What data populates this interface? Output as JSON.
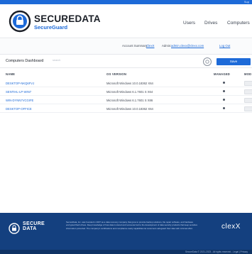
{
  "top_strip": {
    "text": "Sup"
  },
  "brand": {
    "name": "SECUREDATA",
    "sub": "SecureGuard"
  },
  "nav": {
    "users": "Users",
    "drives": "Drives",
    "computers": "Computers"
  },
  "subbar": {
    "account_label": "Account Summary:",
    "account_value": "ClexX",
    "admin_label": "Admin:",
    "admin_value": "admin.clexx@clexx.com",
    "logout": "Log Out"
  },
  "toolbar": {
    "title": "Computers Dashboard",
    "search_placeholder": "search",
    "save_label": "Save"
  },
  "table": {
    "headers": {
      "name": "NAME",
      "os": "OS VERSION",
      "managed": "MANAGED",
      "mode": "MOD"
    },
    "rows": [
      {
        "name": "DESKTOP-NKQ6FVJ",
        "os": "Microsoft Windows 10.0.18362 X64"
      },
      {
        "name": "SENTIHL-LP-WIN7",
        "os": "Microsoft Windows 6.1.7601 S X64"
      },
      {
        "name": "WIN-DYNN7VCGIFE",
        "os": "Microsoft Windows 6.1.7601 S X86"
      },
      {
        "name": "DESKTOP-OFFICE",
        "os": "Microsoft Windows 10.0.18362 X64"
      }
    ]
  },
  "footer": {
    "name_line1": "SECURE",
    "name_line2": "DATA",
    "text": "SecureData, Inc. was founded in 2007 as a data recovery company that grew to provide backup solutions, file repair software, and hardware encrypted flash drives. Deep knowledge of how data is stored and recovered led to the development of data security products that keep sensitive information protected. The company's certifications and compliance-ready capabilities let customers safeguard their data with minimal effort.",
    "clex_logo": "clexX"
  },
  "bottom_bar": {
    "text": "SecureData © 2021-2023 - All rights reserved - Legal | Privacy"
  },
  "colors": {
    "accent": "#1d6ad8",
    "footer": "#14407f"
  }
}
